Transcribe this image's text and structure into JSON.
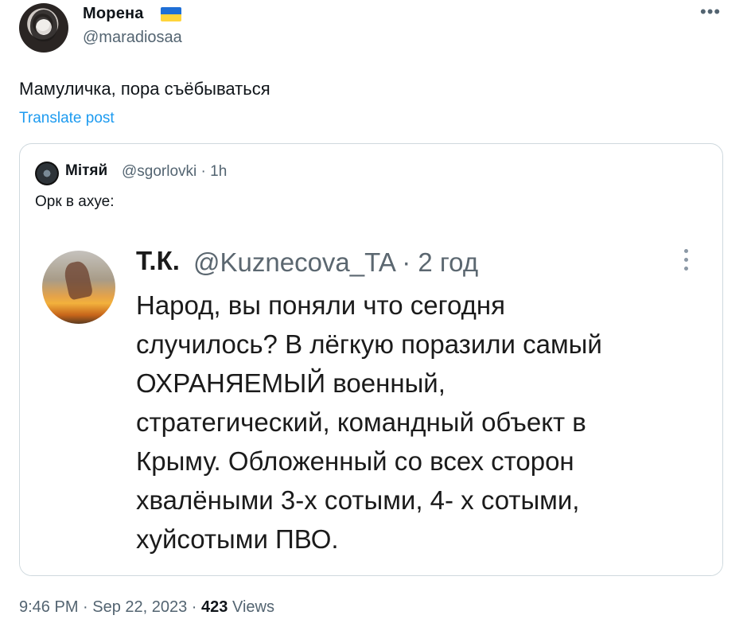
{
  "author": {
    "name": "Морена",
    "handle": "@maradiosaa",
    "flag_colors": [
      "#1f6fd6",
      "#ffd43b"
    ]
  },
  "tweet": {
    "text": "Мамуличка, пора съёбываться",
    "translate_label": "Translate post"
  },
  "quote": {
    "name": "Мітяй",
    "handle_time": "@sgorlovki · 1h",
    "text": "Орк в ахуе:",
    "embedded": {
      "name": "Т.К.",
      "handle_time": "@Kuznecova_TA · 2 год",
      "lines": [
        "Народ, вы поняли что сегодня",
        "случилось? В лёгкую поразили самый",
        "ОХРАНЯЕМЫЙ военный,",
        "стратегический, командный объект в",
        "Крыму. Обложенный со всех сторон",
        "хвалёными 3-х сотыми, 4- х сотыми,",
        "хуйсотыми ПВО."
      ]
    }
  },
  "footer": {
    "time_date": "9:46 PM · Sep 22, 2023 · ",
    "views_count": "423",
    "views_label": " Views"
  },
  "icons": {
    "more": "more-horizontal-icon",
    "embedded_more": "more-vertical-icon"
  }
}
